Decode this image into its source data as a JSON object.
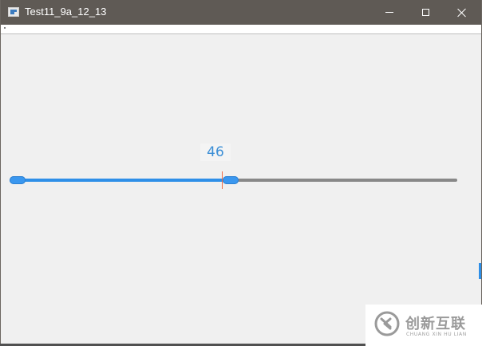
{
  "window": {
    "title": "Test11_9a_12_13",
    "icon": "app-window-icon",
    "controls": [
      "minimize-icon",
      "maximize-icon",
      "close-icon"
    ]
  },
  "slider": {
    "value_label": "46",
    "value": 46,
    "range": [
      0,
      100
    ],
    "fill_color": "#2e8fe8",
    "rest_color": "#888888",
    "handle_color": "#3a97ef",
    "marker_color": "#ef6b45",
    "label_color": "#3a8ed6"
  },
  "watermark": {
    "brand": "创新互联",
    "subtitle": "CHUANG XIN HU LIAN"
  }
}
